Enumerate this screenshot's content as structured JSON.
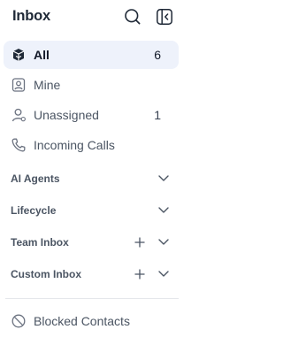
{
  "header": {
    "title": "Inbox"
  },
  "nav": [
    {
      "label": "All",
      "count": "6",
      "icon": "inbox-box-icon",
      "active": true
    },
    {
      "label": "Mine",
      "count": "",
      "icon": "user-badge-icon",
      "active": false
    },
    {
      "label": "Unassigned",
      "count": "1",
      "icon": "user-outline-icon",
      "active": false
    },
    {
      "label": "Incoming Calls",
      "count": "",
      "icon": "phone-icon",
      "active": false
    }
  ],
  "sections": [
    {
      "label": "AI Agents",
      "has_add": false
    },
    {
      "label": "Lifecycle",
      "has_add": false
    },
    {
      "label": "Team Inbox",
      "has_add": true
    },
    {
      "label": "Custom Inbox",
      "has_add": true
    }
  ],
  "footer": {
    "label": "Blocked Contacts",
    "icon": "block-icon"
  },
  "colors": {
    "active_bg": "#eef2fb",
    "text_primary": "#111827",
    "text_secondary": "#4b5563",
    "divider": "#e5e7eb"
  }
}
